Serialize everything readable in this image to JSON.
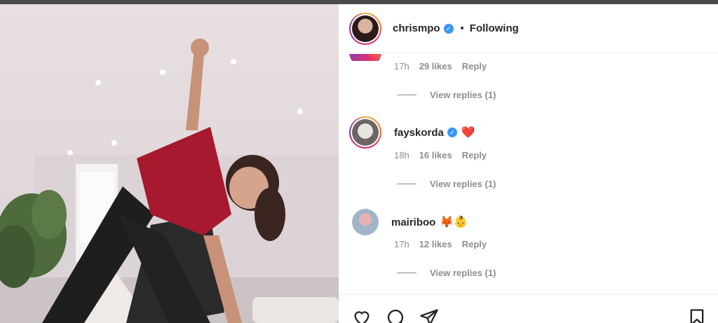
{
  "post": {
    "author": "chrismpo",
    "verified": true,
    "separator": "•",
    "follow_status": "Following"
  },
  "top_comment_tail": {
    "time": "17h",
    "likes": "29 likes",
    "reply": "Reply",
    "view_replies": "View replies (1)"
  },
  "comments": [
    {
      "username": "fayskorda",
      "verified": true,
      "emoji": "❤️",
      "time": "18h",
      "likes": "16 likes",
      "reply": "Reply",
      "view_replies": "View replies (1)"
    },
    {
      "username": "mairiboo",
      "verified": false,
      "emoji": "🦊👶",
      "time": "17h",
      "likes": "12 likes",
      "reply": "Reply",
      "view_replies": "View replies (1)"
    }
  ],
  "icons": [
    "heart-icon",
    "comment-icon",
    "share-icon",
    "bookmark-icon",
    "verified-badge-icon"
  ],
  "colors": {
    "verified": "#3897f0",
    "meta_text": "#8e8e8e",
    "text": "#262626",
    "story_ring": "#e1306c"
  }
}
